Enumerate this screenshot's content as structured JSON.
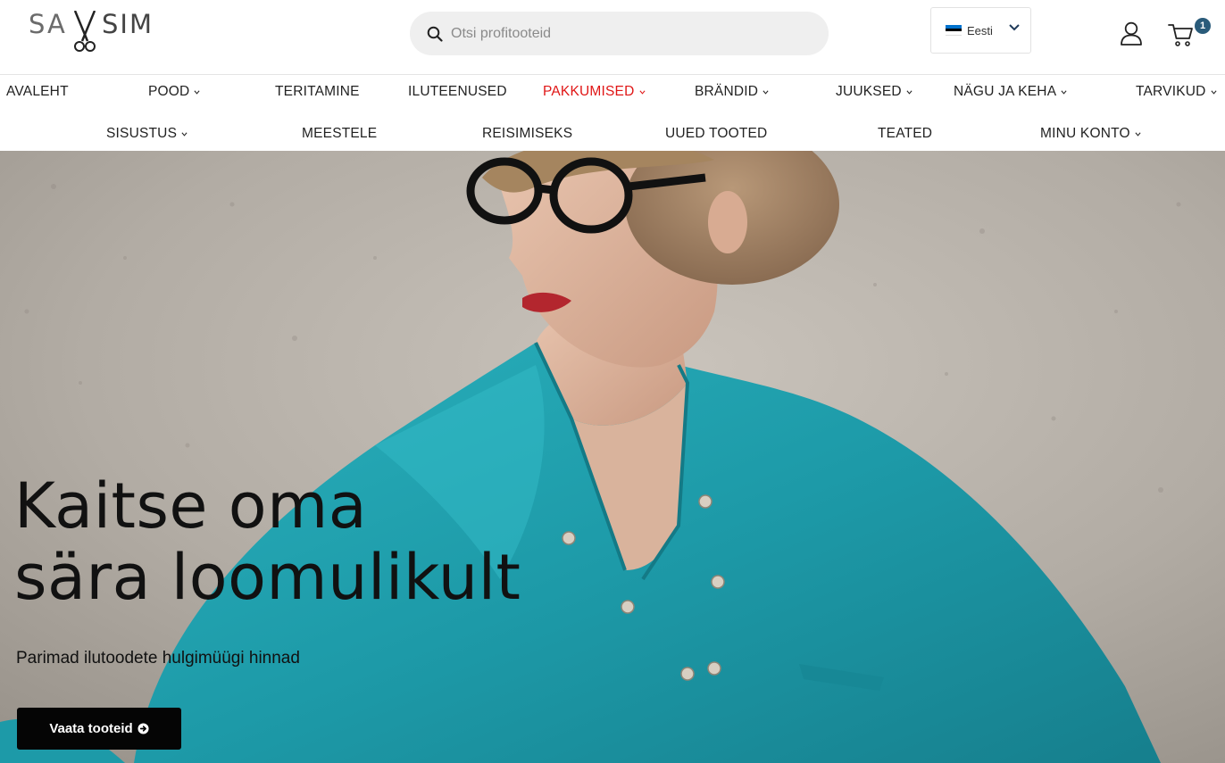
{
  "header": {
    "logo": {
      "left_text": "SA",
      "right_text": "SIM"
    },
    "search": {
      "placeholder": "Otsi profitooteid",
      "icon": "search-icon"
    },
    "language": {
      "label": "Eesti",
      "flag_colors": [
        "#0072ce",
        "#000000",
        "#ffffff"
      ]
    },
    "account_icon": "user-icon",
    "cart": {
      "icon": "cart-icon",
      "count": "1"
    }
  },
  "nav": {
    "row1": [
      {
        "label": "AVALEHT",
        "dropdown": false
      },
      {
        "label": "POOD",
        "dropdown": true
      },
      {
        "label": "TERITAMINE",
        "dropdown": false
      },
      {
        "label": "ILUTEENUSED",
        "dropdown": false
      },
      {
        "label": "PAKKUMISED",
        "dropdown": true,
        "active": true
      },
      {
        "label": "BRÄNDID",
        "dropdown": true
      },
      {
        "label": "JUUKSED",
        "dropdown": true
      },
      {
        "label": "NÄGU JA KEHA",
        "dropdown": true
      },
      {
        "label": "TARVIKUD",
        "dropdown": true
      }
    ],
    "row2": [
      {
        "label": "SISUSTUS",
        "dropdown": true
      },
      {
        "label": "MEESTELE",
        "dropdown": false
      },
      {
        "label": "REISIMISEKS",
        "dropdown": false
      },
      {
        "label": "UUED TOOTED",
        "dropdown": false
      },
      {
        "label": "TEATED",
        "dropdown": false
      },
      {
        "label": "MINU KONTO",
        "dropdown": true
      }
    ]
  },
  "hero": {
    "title_line1": "Kaitse oma",
    "title_line2": "sära loomulikult",
    "subtitle": "Parimad ilutoodete hulgimüügi hinnad",
    "button_label": "Vaata tooteid"
  },
  "colors": {
    "accent_active": "#e01616",
    "cart_badge": "#2a5b7a",
    "button_bg": "#050505",
    "shirt": "#1fa0ad"
  }
}
